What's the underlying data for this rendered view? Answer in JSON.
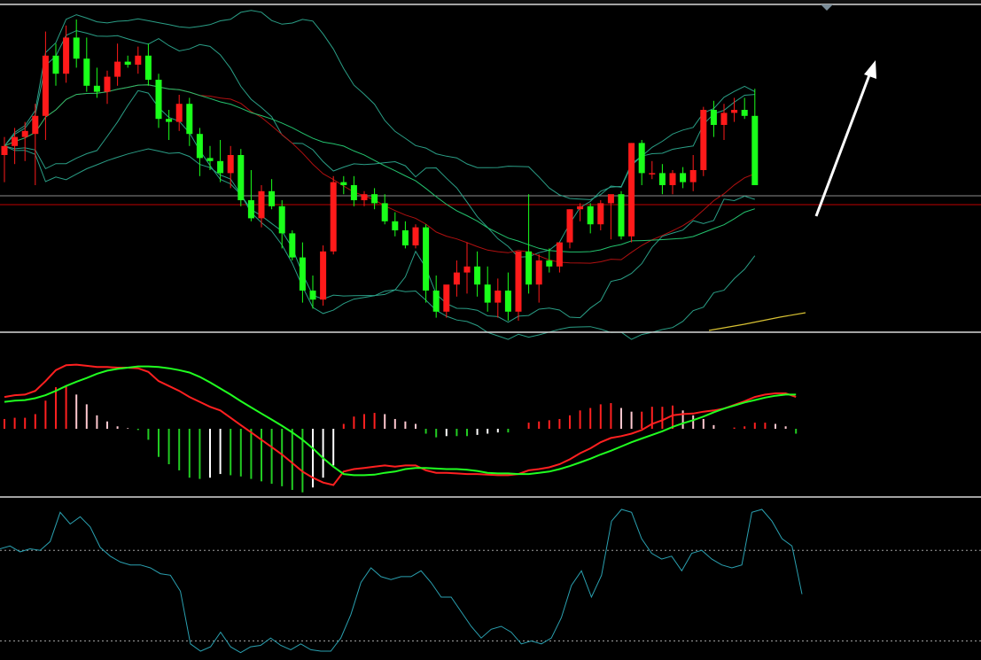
{
  "colors": {
    "background": "#000000",
    "up": "#ff1a1a",
    "down": "#1aff1a",
    "separator": "#d8d8d8",
    "bb_line": "#2a9e86",
    "ma_red": "#b01010",
    "ma_green": "#23c26e",
    "ma_yellow": "#d8c233",
    "hline_gray": "#8d8d8d",
    "hline_red": "#c00000",
    "dif": "#ff2020",
    "dea": "#20ff20",
    "hist_pos_strong": "#ff2020",
    "hist_pos_weak": "#ffc8d0",
    "hist_neg_strong": "#22cc22",
    "hist_neg_weak": "#ffffff",
    "osc": "#2aa0b0",
    "osc_ref": "#a0a0a0",
    "arrow": "#ffffff"
  },
  "icons": {
    "top_marker": "triangle-down-icon",
    "trend_arrow": "up-arrow-icon"
  },
  "chart_data": [
    {
      "type": "candlestick",
      "panel": "price",
      "ylim": [
        0,
        100
      ],
      "candles": [
        {
          "o": 55,
          "h": 61,
          "l": 46,
          "c": 58
        },
        {
          "o": 58,
          "h": 64,
          "l": 52,
          "c": 61
        },
        {
          "o": 61,
          "h": 66,
          "l": 53,
          "c": 63
        },
        {
          "o": 62,
          "h": 72,
          "l": 45,
          "c": 68
        },
        {
          "o": 68,
          "h": 96,
          "l": 60,
          "c": 88
        },
        {
          "o": 88,
          "h": 92,
          "l": 78,
          "c": 82
        },
        {
          "o": 82,
          "h": 98,
          "l": 79,
          "c": 94
        },
        {
          "o": 94,
          "h": 100,
          "l": 84,
          "c": 87
        },
        {
          "o": 87,
          "h": 94,
          "l": 76,
          "c": 78
        },
        {
          "o": 78,
          "h": 84,
          "l": 74,
          "c": 76
        },
        {
          "o": 76,
          "h": 83,
          "l": 72,
          "c": 81
        },
        {
          "o": 81,
          "h": 92,
          "l": 78,
          "c": 86
        },
        {
          "o": 86,
          "h": 88,
          "l": 84,
          "c": 85
        },
        {
          "o": 85,
          "h": 91,
          "l": 82,
          "c": 88
        },
        {
          "o": 88,
          "h": 92,
          "l": 78,
          "c": 80
        },
        {
          "o": 80,
          "h": 82,
          "l": 64,
          "c": 67
        },
        {
          "o": 67,
          "h": 70,
          "l": 60,
          "c": 66
        },
        {
          "o": 66,
          "h": 75,
          "l": 63,
          "c": 72
        },
        {
          "o": 72,
          "h": 74,
          "l": 58,
          "c": 62
        },
        {
          "o": 62,
          "h": 64,
          "l": 48,
          "c": 54
        },
        {
          "o": 54,
          "h": 58,
          "l": 50,
          "c": 53
        },
        {
          "o": 53,
          "h": 60,
          "l": 46,
          "c": 49
        },
        {
          "o": 49,
          "h": 58,
          "l": 44,
          "c": 55
        },
        {
          "o": 55,
          "h": 57,
          "l": 38,
          "c": 40
        },
        {
          "o": 40,
          "h": 50,
          "l": 33,
          "c": 34
        },
        {
          "o": 34,
          "h": 45,
          "l": 31,
          "c": 43
        },
        {
          "o": 43,
          "h": 47,
          "l": 37,
          "c": 38
        },
        {
          "o": 38,
          "h": 40,
          "l": 24,
          "c": 29
        },
        {
          "o": 29,
          "h": 30,
          "l": 20,
          "c": 21
        },
        {
          "o": 21,
          "h": 26,
          "l": 6,
          "c": 10
        },
        {
          "o": 10,
          "h": 15,
          "l": 4,
          "c": 7
        },
        {
          "o": 7,
          "h": 25,
          "l": 5,
          "c": 23
        },
        {
          "o": 23,
          "h": 48,
          "l": 22,
          "c": 46
        },
        {
          "o": 46,
          "h": 48,
          "l": 42,
          "c": 45
        },
        {
          "o": 45,
          "h": 48,
          "l": 38,
          "c": 40
        },
        {
          "o": 40,
          "h": 43,
          "l": 38,
          "c": 42
        },
        {
          "o": 42,
          "h": 44,
          "l": 37,
          "c": 39
        },
        {
          "o": 39,
          "h": 42,
          "l": 32,
          "c": 33
        },
        {
          "o": 33,
          "h": 36,
          "l": 28,
          "c": 30
        },
        {
          "o": 30,
          "h": 33,
          "l": 24,
          "c": 25
        },
        {
          "o": 25,
          "h": 32,
          "l": 24,
          "c": 31
        },
        {
          "o": 31,
          "h": 32,
          "l": 6,
          "c": 10
        },
        {
          "o": 10,
          "h": 15,
          "l": 1,
          "c": 3
        },
        {
          "o": 3,
          "h": 11,
          "l": 1,
          "c": 12
        },
        {
          "o": 12,
          "h": 20,
          "l": 8,
          "c": 16
        },
        {
          "o": 16,
          "h": 26,
          "l": 9,
          "c": 18
        },
        {
          "o": 18,
          "h": 23,
          "l": 8,
          "c": 12
        },
        {
          "o": 12,
          "h": 18,
          "l": 3,
          "c": 6
        },
        {
          "o": 6,
          "h": 14,
          "l": 1,
          "c": 10
        },
        {
          "o": 10,
          "h": 16,
          "l": 0,
          "c": 3
        },
        {
          "o": 3,
          "h": 22,
          "l": 0,
          "c": 23
        },
        {
          "o": 23,
          "h": 42,
          "l": 9,
          "c": 12
        },
        {
          "o": 12,
          "h": 22,
          "l": 6,
          "c": 20
        },
        {
          "o": 20,
          "h": 24,
          "l": 16,
          "c": 18
        },
        {
          "o": 18,
          "h": 24,
          "l": 16,
          "c": 26
        },
        {
          "o": 26,
          "h": 37,
          "l": 24,
          "c": 37
        },
        {
          "o": 37,
          "h": 39,
          "l": 33,
          "c": 38
        },
        {
          "o": 38,
          "h": 39,
          "l": 29,
          "c": 32
        },
        {
          "o": 32,
          "h": 40,
          "l": 30,
          "c": 39
        },
        {
          "o": 39,
          "h": 41,
          "l": 27,
          "c": 42
        },
        {
          "o": 42,
          "h": 43,
          "l": 27,
          "c": 28
        },
        {
          "o": 28,
          "h": 59,
          "l": 26,
          "c": 59
        },
        {
          "o": 59,
          "h": 60,
          "l": 45,
          "c": 49
        },
        {
          "o": 49,
          "h": 53,
          "l": 47,
          "c": 49
        },
        {
          "o": 49,
          "h": 52,
          "l": 42,
          "c": 45
        },
        {
          "o": 45,
          "h": 50,
          "l": 42,
          "c": 49
        },
        {
          "o": 49,
          "h": 51,
          "l": 44,
          "c": 46
        },
        {
          "o": 46,
          "h": 55,
          "l": 43,
          "c": 50
        },
        {
          "o": 50,
          "h": 71,
          "l": 48,
          "c": 70
        },
        {
          "o": 70,
          "h": 73,
          "l": 61,
          "c": 65
        },
        {
          "o": 65,
          "h": 72,
          "l": 60,
          "c": 69
        },
        {
          "o": 69,
          "h": 74,
          "l": 66,
          "c": 70
        },
        {
          "o": 70,
          "h": 74,
          "l": 67,
          "c": 68
        },
        {
          "o": 68,
          "h": 77,
          "l": 46,
          "c": 45
        }
      ]
    },
    {
      "type": "line",
      "panel": "macd",
      "ylim": [
        -1,
        1
      ],
      "series": [
        {
          "key": "dif",
          "values": [
            0.52,
            0.55,
            0.56,
            0.62,
            0.78,
            0.96,
            1.04,
            1.05,
            1.03,
            1.01,
            1.01,
            1.0,
            1.0,
            0.99,
            0.93,
            0.78,
            0.7,
            0.62,
            0.52,
            0.44,
            0.36,
            0.3,
            0.18,
            0.06,
            -0.06,
            -0.18,
            -0.3,
            -0.42,
            -0.56,
            -0.7,
            -0.8,
            -0.88,
            -0.92,
            -0.7,
            -0.66,
            -0.64,
            -0.62,
            -0.6,
            -0.62,
            -0.6,
            -0.6,
            -0.68,
            -0.72,
            -0.72,
            -0.73,
            -0.74,
            -0.74,
            -0.75,
            -0.76,
            -0.76,
            -0.74,
            -0.68,
            -0.66,
            -0.63,
            -0.58,
            -0.5,
            -0.4,
            -0.32,
            -0.22,
            -0.15,
            -0.12,
            -0.08,
            -0.02,
            0.08,
            0.14,
            0.22,
            0.24,
            0.25,
            0.28,
            0.3,
            0.33,
            0.39,
            0.45,
            0.52,
            0.56,
            0.58,
            0.58,
            0.52
          ]
        },
        {
          "key": "dea",
          "values": [
            0.44,
            0.46,
            0.47,
            0.5,
            0.55,
            0.62,
            0.7,
            0.77,
            0.83,
            0.9,
            0.95,
            0.98,
            1.0,
            1.02,
            1.02,
            1.01,
            0.99,
            0.96,
            0.92,
            0.85,
            0.76,
            0.66,
            0.56,
            0.45,
            0.35,
            0.25,
            0.15,
            0.05,
            -0.06,
            -0.18,
            -0.32,
            -0.48,
            -0.62,
            -0.74,
            -0.76,
            -0.76,
            -0.75,
            -0.72,
            -0.7,
            -0.66,
            -0.64,
            -0.64,
            -0.65,
            -0.66,
            -0.66,
            -0.67,
            -0.69,
            -0.72,
            -0.73,
            -0.73,
            -0.74,
            -0.74,
            -0.72,
            -0.7,
            -0.66,
            -0.61,
            -0.55,
            -0.49,
            -0.42,
            -0.36,
            -0.29,
            -0.22,
            -0.16,
            -0.1,
            -0.04,
            0.03,
            0.09,
            0.14,
            0.2,
            0.27,
            0.33,
            0.38,
            0.43,
            0.47,
            0.51,
            0.54,
            0.56,
            0.56
          ]
        }
      ],
      "histogram": [
        0.16,
        0.18,
        0.18,
        0.24,
        0.46,
        0.68,
        0.7,
        0.56,
        0.4,
        0.22,
        0.12,
        0.04,
        0.01,
        -0.02,
        -0.18,
        -0.46,
        -0.58,
        -0.68,
        -0.8,
        -0.82,
        -0.8,
        -0.74,
        -0.76,
        -0.78,
        -0.82,
        -0.86,
        -0.9,
        -0.94,
        -1.0,
        -1.04,
        -0.96,
        -0.8,
        -0.6,
        0.08,
        0.2,
        0.24,
        0.26,
        0.24,
        0.16,
        0.12,
        0.08,
        -0.08,
        -0.14,
        -0.12,
        -0.12,
        -0.12,
        -0.1,
        -0.08,
        -0.06,
        -0.06,
        0.0,
        0.1,
        0.12,
        0.14,
        0.16,
        0.22,
        0.3,
        0.34,
        0.4,
        0.42,
        0.34,
        0.28,
        0.28,
        0.36,
        0.36,
        0.38,
        0.3,
        0.22,
        0.16,
        0.06,
        0.0,
        0.02,
        0.04,
        0.1,
        0.1,
        0.08,
        0.04,
        -0.08
      ]
    },
    {
      "type": "line",
      "panel": "oscillator",
      "ylim": [
        0,
        100
      ],
      "series": [
        {
          "key": "osc",
          "values": [
            73,
            75,
            71,
            73,
            72,
            78,
            98,
            90,
            95,
            88,
            74,
            68,
            64,
            62,
            62,
            60,
            56,
            55,
            44,
            8,
            3,
            6,
            16,
            6,
            2,
            6,
            7,
            12,
            7,
            4,
            8,
            4,
            3,
            3,
            12,
            28,
            50,
            60,
            54,
            52,
            54,
            54,
            58,
            50,
            40,
            40,
            30,
            20,
            12,
            18,
            20,
            16,
            8,
            10,
            8,
            12,
            26,
            48,
            58,
            40,
            55,
            92,
            100,
            98,
            80,
            70,
            66,
            68,
            58,
            70,
            72,
            66,
            62,
            60,
            62,
            98,
            100,
            92,
            80,
            75,
            42
          ]
        }
      ],
      "reference_lines": [
        72,
        10
      ]
    }
  ]
}
